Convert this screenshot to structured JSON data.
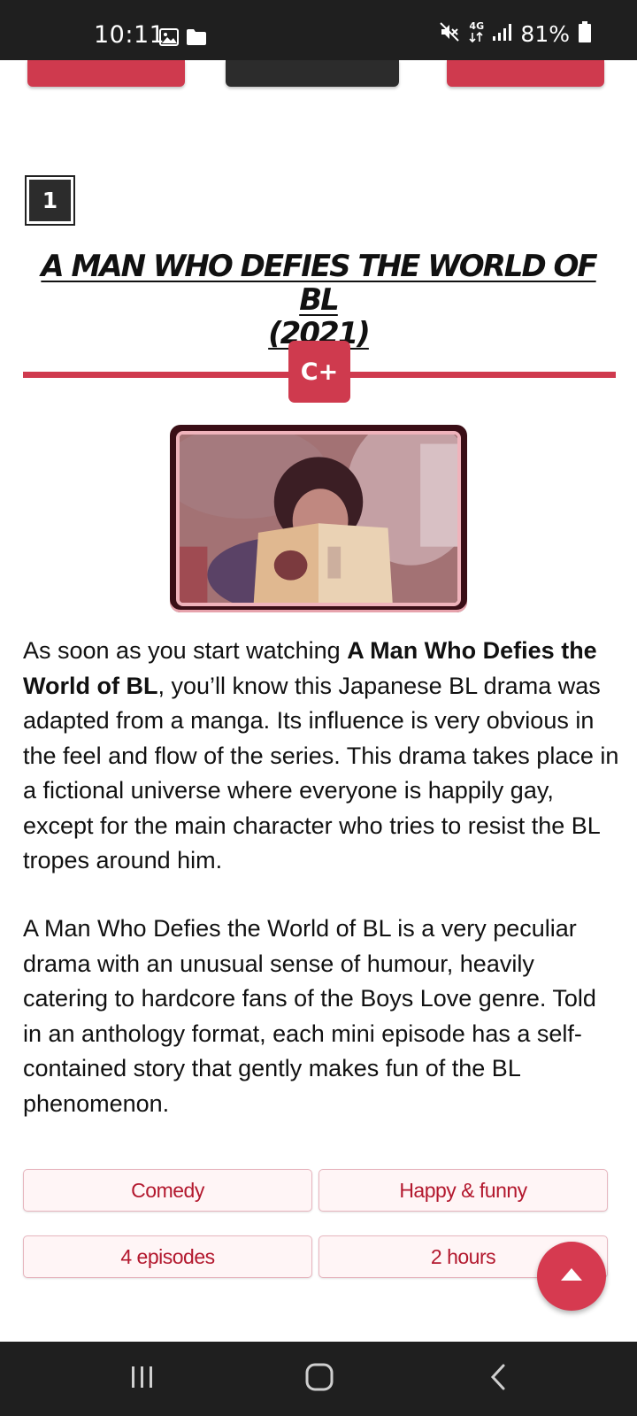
{
  "status_bar": {
    "time": "10:11",
    "network": "4G",
    "battery": "81%",
    "icons": [
      "gallery-icon",
      "folder-icon",
      "mute-icon",
      "data-arrows-icon",
      "signal-icon",
      "battery-icon"
    ]
  },
  "entry": {
    "rank": "1",
    "title_line1": "A MAN WHO DEFIES THE WORLD OF BL",
    "title_line2": "(2021)",
    "grade": "C+",
    "paragraph1": {
      "before": "As soon as you start watching ",
      "bold": "A Man Who Defies the World of BL",
      "after": ", you’ll know this Japanese BL drama was adapted from a manga. Its influence is very obvious in the feel and flow of the series. This drama takes place in a fictional universe where everyone is happily gay, except for the main character who tries to resist the BL tropes around him."
    },
    "paragraph2": "A Man Who Defies the World of BL is a very peculiar drama with an unusual sense of humour, heavily catering to hardcore fans of the Boys Love genre. Told in an anthology format, each mini episode has a self-contained story that gently makes fun of the BL phenomenon.",
    "tags": [
      "Comedy",
      "Happy & funny",
      "4 episodes",
      "2 hours"
    ]
  },
  "colors": {
    "accent": "#cf3a4e",
    "dark": "#2c2c2c",
    "tag_text": "#b3182e",
    "tag_bg": "#fff5f6",
    "system_bar": "#1f1f1f"
  }
}
